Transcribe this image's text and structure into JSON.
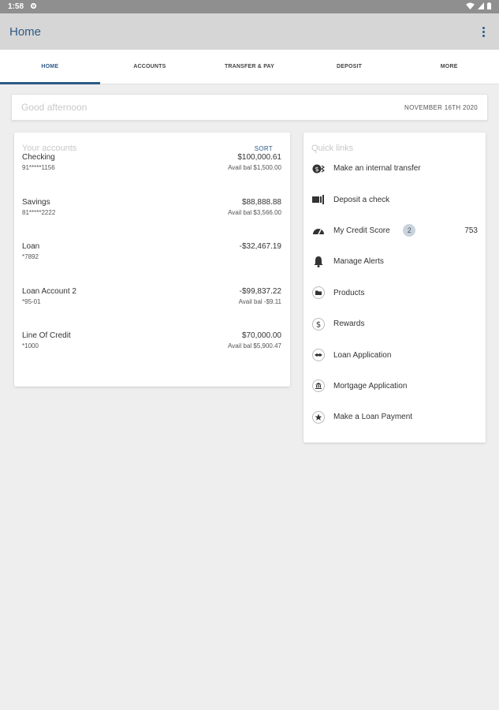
{
  "status": {
    "time": "1:58"
  },
  "appbar": {
    "title": "Home"
  },
  "tabs": [
    {
      "label": "HOME",
      "active": true
    },
    {
      "label": "ACCOUNTS"
    },
    {
      "label": "TRANSFER & PAY"
    },
    {
      "label": "DEPOSIT"
    },
    {
      "label": "MORE"
    }
  ],
  "greeting": {
    "text": "Good afternoon",
    "date": "NOVEMBER 16TH 2020"
  },
  "accounts": {
    "heading": "Your accounts",
    "sort_label": "SORT",
    "items": [
      {
        "name": "Checking",
        "number": "91*****1156",
        "amount": "$100,000.61",
        "avail": "Avail bal $1,500.00"
      },
      {
        "name": "Savings",
        "number": "81*****2222",
        "amount": "$88,888.88",
        "avail": "Avail bal $3,566.00"
      },
      {
        "name": "Loan",
        "number": "*7892",
        "amount": "-$32,467.19",
        "avail": ""
      },
      {
        "name": "Loan Account 2",
        "number": "*95-01",
        "amount": "-$99,837.22",
        "avail": "Avail bal -$9.11"
      },
      {
        "name": "Line Of Credit",
        "number": "*1000",
        "amount": "$70,000.00",
        "avail": "Avail bal $5,900.47"
      }
    ]
  },
  "quick_links": {
    "heading": "Quick links",
    "items": [
      {
        "label": "Make an internal transfer",
        "icon": "transfer-icon"
      },
      {
        "label": "Deposit a check",
        "icon": "deposit-check-icon"
      },
      {
        "label": "My Credit Score",
        "icon": "gauge-icon",
        "badge": "2",
        "value": "753"
      },
      {
        "label": "Manage Alerts",
        "icon": "bell-icon"
      },
      {
        "label": "Products",
        "icon": "folder-icon"
      },
      {
        "label": "Rewards",
        "icon": "dollar-icon"
      },
      {
        "label": "Loan Application",
        "icon": "handshake-icon"
      },
      {
        "label": "Mortgage Application",
        "icon": "bank-icon"
      },
      {
        "label": "Make a Loan Payment",
        "icon": "star-icon"
      }
    ]
  },
  "colors": {
    "accent": "#2e5a88",
    "appbar": "#d6d6d6",
    "statusbar": "#8f8f8f",
    "background": "#eeeeee"
  }
}
